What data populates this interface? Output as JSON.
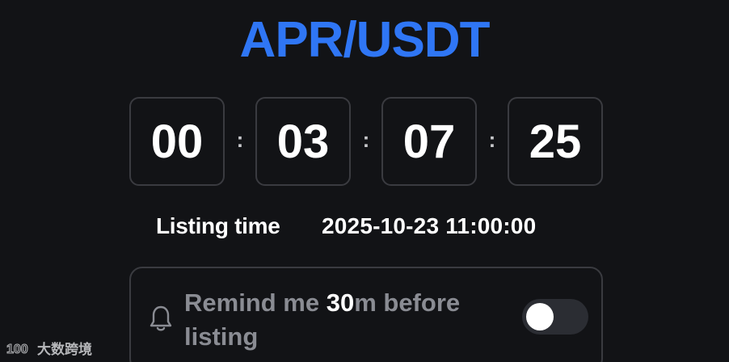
{
  "header": {
    "pair": "APR/USDT",
    "accent_color": "#2f76f5"
  },
  "countdown": {
    "days": "00",
    "hours": "03",
    "minutes": "07",
    "seconds": "25",
    "separator": ":"
  },
  "listing": {
    "label": "Listing time",
    "value": "2025-10-23 11:00:00"
  },
  "reminder": {
    "text_prefix": "Remind me ",
    "text_highlight": "30",
    "text_suffix": "m before listing",
    "toggle_on": false,
    "icon": "bell-icon"
  },
  "watermark": {
    "logo_text": "100",
    "text": "大数跨境"
  }
}
